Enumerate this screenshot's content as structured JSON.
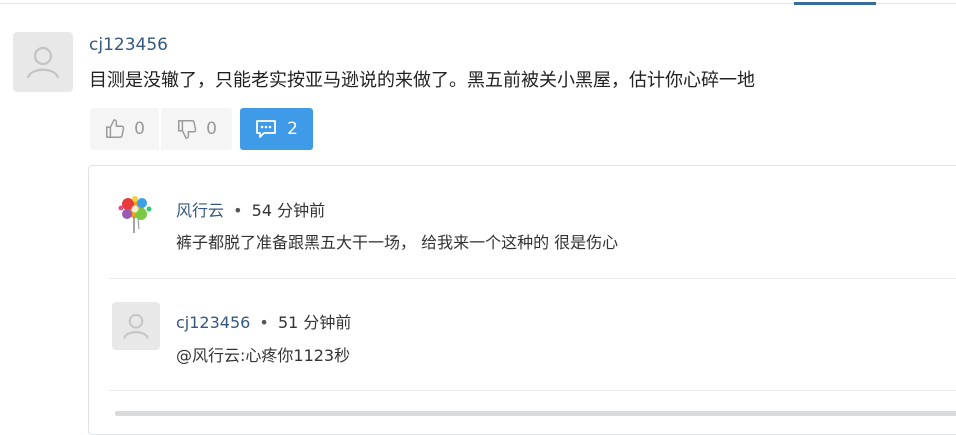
{
  "comment": {
    "username": "cj123456",
    "text": "目测是没辙了，只能老实按亚马逊说的来做了。黑五前被关小黑屋，估计你心碎一地",
    "upvotes": "0",
    "downvotes": "0",
    "reply_count": "2"
  },
  "replies": [
    {
      "username": "风行云",
      "separator": "•",
      "time": "54 分钟前",
      "text": "裤子都脱了准备跟黑五大干一场， 给我来一个这种的 很是伤心",
      "avatar_icon": "colorful-splash-avatar"
    },
    {
      "username": "cj123456",
      "separator": "•",
      "time": "51 分钟前",
      "text": "@风行云:心疼你1123秒",
      "avatar_icon": "default-user-avatar"
    }
  ],
  "colors": {
    "accent": "#3f9be8",
    "username": "#35587e",
    "tab_indicator": "#3a6d9c"
  }
}
